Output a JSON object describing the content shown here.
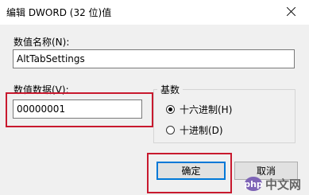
{
  "dialog": {
    "title": "编辑 DWORD (32 位)值",
    "close_icon": "close-icon"
  },
  "value_name": {
    "label": "数值名称(N):",
    "value": "AltTabSettings"
  },
  "value_data": {
    "label": "数值数据(V):",
    "value": "00000001"
  },
  "base": {
    "title": "基数",
    "options": [
      {
        "label": "十六进制(H)",
        "selected": true
      },
      {
        "label": "十进制(D)",
        "selected": false
      }
    ]
  },
  "buttons": {
    "ok": "确定",
    "cancel": "取消"
  },
  "watermark": {
    "logo_text": "php",
    "text": "中文网"
  },
  "colors": {
    "highlight": "#c8192e",
    "default_button_border": "#0078d7"
  }
}
